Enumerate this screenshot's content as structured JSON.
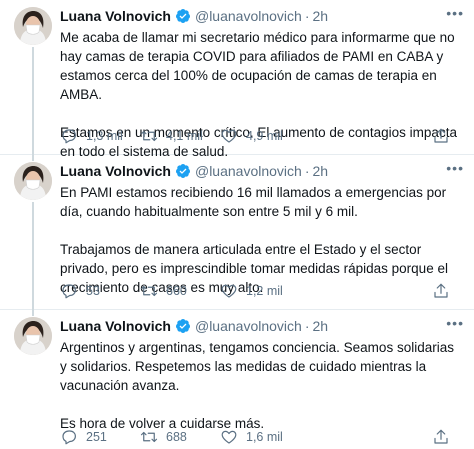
{
  "author": {
    "name": "Luana Volnovich",
    "handle": "@luanavolnovich"
  },
  "colors": {
    "accent": "#1da1f2",
    "text": "#0f1419",
    "secondary": "#5b7083",
    "divider": "#e6ecf0"
  },
  "tweets": [
    {
      "time": "2h",
      "paragraphs": [
        "Me acaba de llamar mi secretario médico para informarme que no hay camas de terapia COVID para afiliados de PAMI en CABA y estamos cerca del 100% de ocupación de camas de terapia en AMBA.",
        "Estamos en un momento crítico. El aumento de contagios impacta en todo el sistema de salud."
      ],
      "replies": "1,3 mil",
      "retweets": "4,1 mil",
      "likes": "4,9 mil"
    },
    {
      "time": "2h",
      "paragraphs": [
        "En PAMI estamos recibiendo 16 mil llamados a emergencias por día, cuando habitualmente son entre 5 mil y 6 mil.",
        "Trabajamos de manera articulada entre el Estado y el sector privado, pero es imprescindible tomar medidas rápidas porque el crecimiento de casos es muy alto."
      ],
      "replies": "53",
      "retweets": "660",
      "likes": "1,2 mil"
    },
    {
      "time": "2h",
      "paragraphs": [
        "Argentinos y argentinas, tengamos conciencia. Seamos solidarias y solidarios. Respetemos las medidas de cuidado mientras la vacunación avanza.",
        "Es hora de volver a cuidarse más."
      ],
      "replies": "251",
      "retweets": "688",
      "likes": "1,6 mil"
    }
  ]
}
